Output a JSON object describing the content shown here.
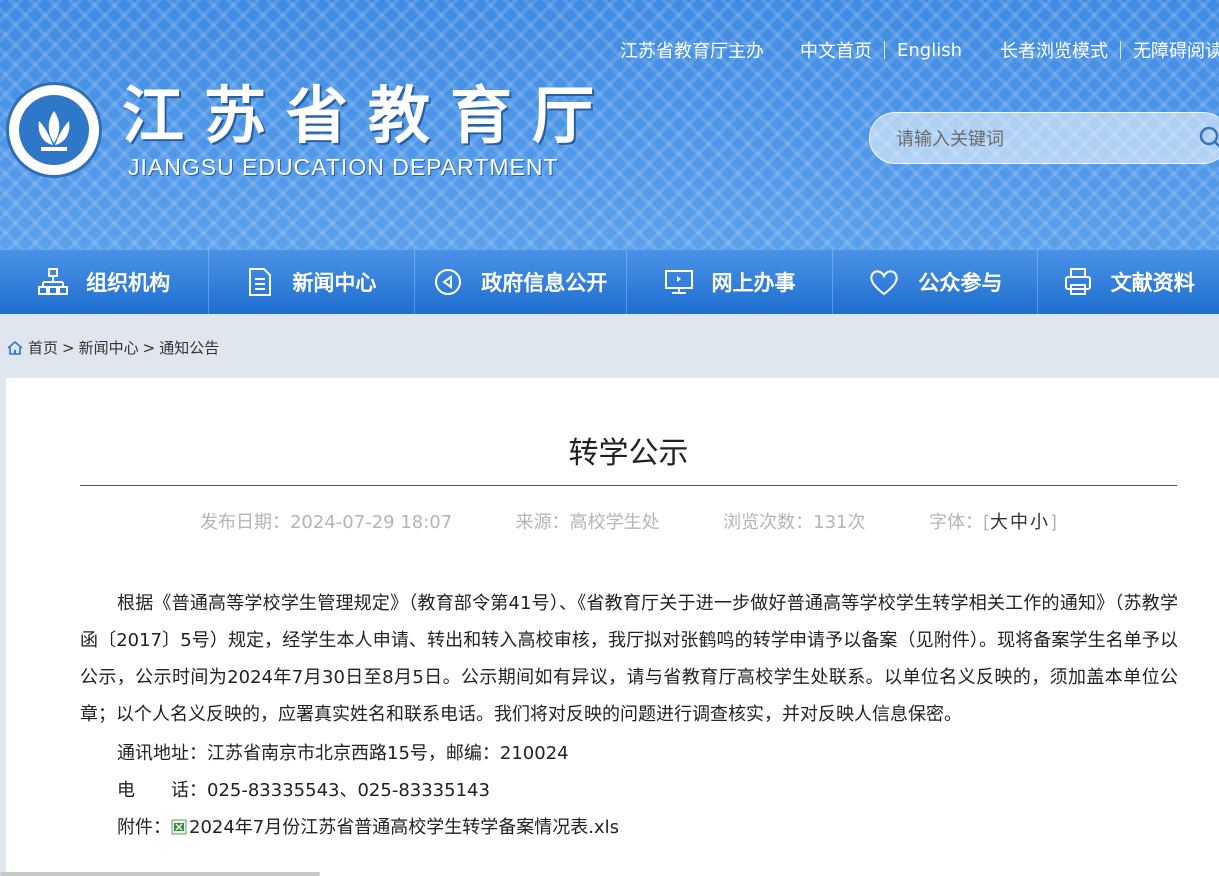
{
  "header": {
    "host_text": "江苏省教育厅主办",
    "links": [
      "中文首页",
      "English",
      "长者浏览模式",
      "无障碍阅读"
    ],
    "site_title": "江苏省教育厅",
    "site_subtitle": "JIANGSU EDUCATION DEPARTMENT",
    "search_placeholder": "请输入关键词"
  },
  "nav": {
    "items": [
      {
        "label": "组织机构",
        "icon": "org-chart-icon"
      },
      {
        "label": "新闻中心",
        "icon": "document-icon"
      },
      {
        "label": "政府信息公开",
        "icon": "play-circle-icon"
      },
      {
        "label": "网上办事",
        "icon": "monitor-icon"
      },
      {
        "label": "公众参与",
        "icon": "heart-icon"
      },
      {
        "label": "文献资料",
        "icon": "printer-icon"
      }
    ]
  },
  "breadcrumb": {
    "items": [
      "首页",
      "新闻中心",
      "通知公告"
    ],
    "separator": ">"
  },
  "article": {
    "title": "转学公示",
    "meta": {
      "date_label": "发布日期：",
      "date": "2024-07-29 18:07",
      "source_label": "来源：",
      "source": "高校学生处",
      "views_label": "浏览次数：",
      "views": "131次",
      "font_label": "字体：",
      "font_open": "[",
      "font_large": "大",
      "font_medium": "中",
      "font_small": "小",
      "font_close": "]"
    },
    "body": "根据《普通高等学校学生管理规定》（教育部令第41号）、《省教育厅关于进一步做好普通高等学校学生转学相关工作的通知》（苏教学函〔2017〕5号）规定，经学生本人申请、转出和转入高校审核，我厅拟对张鹤鸣的转学申请予以备案（见附件）。现将备案学生名单予以公示，公示时间为2024年7月30日至8月5日。公示期间如有异议，请与省教育厅高校学生处联系。以单位名义反映的，须加盖本单位公章；以个人名义反映的，应署真实姓名和联系电话。我们将对反映的问题进行调查核实，并对反映人信息保密。",
    "address": "通讯地址：江苏省南京市北京西路15号，邮编：210024",
    "phone": "电　　话：025-83335543、025-83335143",
    "attachment_label": "附件：",
    "attachment_name": "2024年7月份江苏省普通高校学生转学备案情况表.xls"
  },
  "colors": {
    "banner": "#4f95e4",
    "nav": "#1f6fcf",
    "page_bg": "#dfe6ee"
  }
}
